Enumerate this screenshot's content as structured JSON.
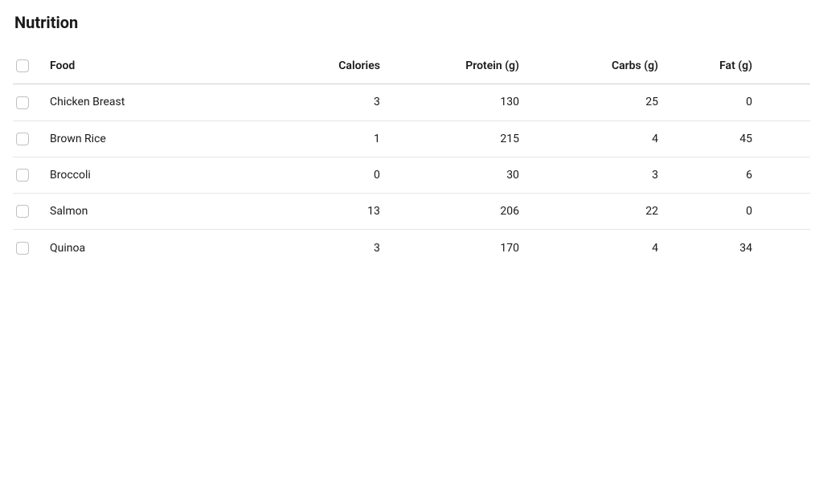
{
  "title": "Nutrition",
  "columns": {
    "food": "Food",
    "calories": "Calories",
    "protein": "Protein (g)",
    "carbs": "Carbs (g)",
    "fat": "Fat (g)"
  },
  "rows": [
    {
      "food": "Chicken Breast",
      "calories": "3",
      "protein": "130",
      "carbs": "25",
      "fat": "0"
    },
    {
      "food": "Brown Rice",
      "calories": "1",
      "protein": "215",
      "carbs": "4",
      "fat": "45"
    },
    {
      "food": "Broccoli",
      "calories": "0",
      "protein": "30",
      "carbs": "3",
      "fat": "6"
    },
    {
      "food": "Salmon",
      "calories": "13",
      "protein": "206",
      "carbs": "22",
      "fat": "0"
    },
    {
      "food": "Quinoa",
      "calories": "3",
      "protein": "170",
      "carbs": "4",
      "fat": "34"
    }
  ]
}
